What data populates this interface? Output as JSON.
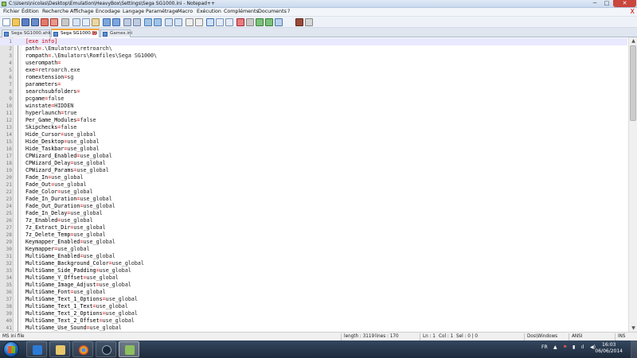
{
  "window": {
    "title": "C:\\Users\\nicolas\\Desktop\\Emulation\\HeavyBox\\Settings\\Sega SG1000.ini - Notepad++",
    "minimize": "─",
    "maximize": "□",
    "close": "✕"
  },
  "menu": {
    "items": [
      "Fichier",
      "Édition",
      "Recherche",
      "Affichage",
      "Encodage",
      "Langage",
      "Paramétrage",
      "Macro",
      "Exécution",
      "Compléments",
      "Documents",
      "?"
    ],
    "close": "X"
  },
  "tabs": [
    {
      "label": "Sega SG1000.ahk",
      "active": false
    },
    {
      "label": "Sega SG1000.ini",
      "active": true
    },
    {
      "label": "Games.ini",
      "active": false
    }
  ],
  "editor": {
    "lines": [
      "[exe info]",
      "path=.\\Emulators\\retroarch\\",
      "rompath=.\\Emulators\\Romfiles\\Sega SG1000\\",
      "userompath=",
      "exe=retroarch.exe",
      "romextension=sg",
      "parameters=",
      "searchsubfolders=",
      "pcgame=false",
      "winstate=HIDDEN",
      "hyperlaunch=true",
      "Per_Game_Modules=false",
      "Skipchecks=false",
      "Hide_Cursor=use_global",
      "Hide_Desktop=use_global",
      "Hide_Taskbar=use_global",
      "CPWizard_Enabled=use_global",
      "CPWizard_Delay=use_global",
      "CPWizard_Params=use_global",
      "Fade_In=use_global",
      "Fade_Out=use_global",
      "Fade_Color=use_global",
      "Fade_In_Duration=use_global",
      "Fade_Out_Duration=use_global",
      "Fade_In_Delay=use_global",
      "7z_Enabled=use_global",
      "7z_Extract_Dir=use_global",
      "7z_Delete_Temp=use_global",
      "Keymapper_Enabled=use_global",
      "Keymapper=use_global",
      "MultiGame_Enabled=use_global",
      "MultiGame_Background_Color=use_global",
      "MultiGame_Side_Padding=use_global",
      "MultiGame_Y_Offset=use_global",
      "MultiGame_Image_Adjust=use_global",
      "MultiGame_Font=use_global",
      "MultiGame_Text_1_Options=use_global",
      "MultiGame_Text_1_Text=use_global",
      "MultiGame_Text_2_Options=use_global",
      "MultiGame_Text_2_Offset=use_global",
      "MultiGame_Use_Sound=use_global"
    ]
  },
  "status": {
    "filetype": "MS ini file",
    "length": "length : 3119",
    "lines": "lines : 170",
    "ln": "Ln : 1",
    "col": "Col : 1",
    "sel": "Sel : 0 | 0",
    "eol": "Dos\\Windows",
    "encoding": "ANSI",
    "mode": "INS"
  },
  "taskbar": {
    "lang": "FR",
    "time": "16:03",
    "date": "06/06/2014"
  },
  "colors": {
    "accent_tab": "#f3a438",
    "key_text": "#000000",
    "operator_red": "#cc0000",
    "current_line": "#e8e8ff"
  }
}
